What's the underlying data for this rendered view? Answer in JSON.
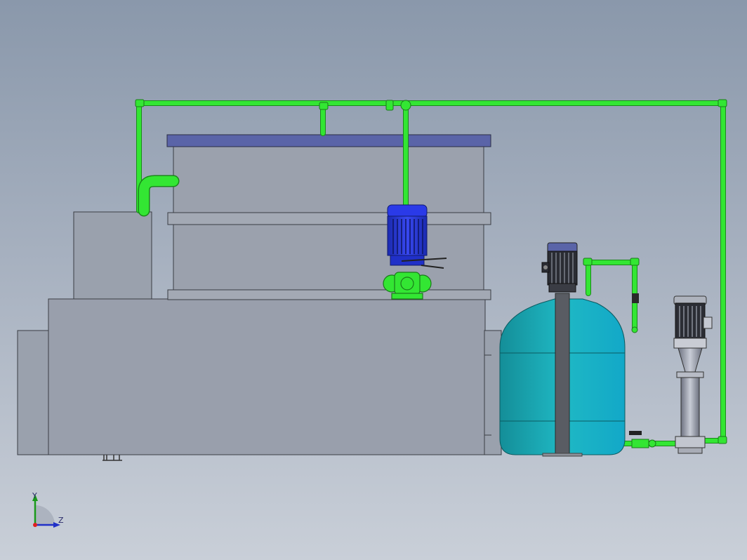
{
  "scene": {
    "colors": {
      "background_top": "#8a98ab",
      "background_bottom": "#c9cfd8",
      "tank_gray": "#9aa1ad",
      "lid_blue": "#5a64a8",
      "pipe_green": "#33e633",
      "motor_blue": "#2030d8",
      "drum_teal": "#1aa6b3"
    },
    "triad": {
      "y_label": "Y",
      "z_label": "Z"
    }
  }
}
